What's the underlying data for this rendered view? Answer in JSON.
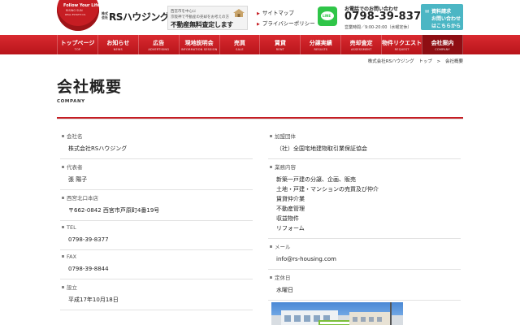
{
  "header": {
    "logo_circle_line1": "Follow Your Life",
    "logo_circle_line2": "RISING SUN",
    "logo_circle_line3": "REAL ESTATE CO.",
    "logo_prefix": "株式会社",
    "company_name": "RSハウジング",
    "banner_line1": "西宮市を中心に",
    "banner_line2": "京阪神で不動産の売却をお考えの方",
    "banner_line3": "不動産無料査定します",
    "links": [
      "サイトマップ",
      "プライバシーポリシー"
    ],
    "line_label": "LINE",
    "phone_label": "お電話でのお問い合わせ",
    "phone_number": "0798-39-8377",
    "hours": "営業時間／9:00-20:00（水曜定休）",
    "request_lines": [
      "資料請求",
      "お問い合わせ",
      "はこちらから"
    ]
  },
  "nav": {
    "items": [
      {
        "jp": "トップページ",
        "en": "TOP"
      },
      {
        "jp": "お知らせ",
        "en": "NEWS"
      },
      {
        "jp": "広告",
        "en": "ADVERTISING"
      },
      {
        "jp": "現地説明会",
        "en": "INFORMATION SESSION"
      },
      {
        "jp": "売買",
        "en": "SALE"
      },
      {
        "jp": "賃貸",
        "en": "RENT"
      },
      {
        "jp": "分譲実績",
        "en": "RESULTS"
      },
      {
        "jp": "売却査定",
        "en": "ASSESSMENT"
      },
      {
        "jp": "物件リクエスト",
        "en": "REQUEST"
      },
      {
        "jp": "会社案内",
        "en": "COMPANY"
      }
    ]
  },
  "breadcrumb": {
    "site": "株式会社RSハウジング",
    "home": "トップ",
    "sep": ">",
    "current": "会社概要"
  },
  "page": {
    "title": "会社概要",
    "subtitle": "COMPANY"
  },
  "info_left": [
    {
      "label": "会社名",
      "value": "株式会社RSハウジング"
    },
    {
      "label": "代表者",
      "value": "張 陽子"
    },
    {
      "label": "西宮北口本店",
      "value": "〒662-0842 西宮市芦原町4番19号"
    },
    {
      "label": "TEL",
      "value": "0798-39-8377"
    },
    {
      "label": "FAX",
      "value": "0798-39-8844"
    },
    {
      "label": "設立",
      "value": "平成17年10月18日"
    }
  ],
  "info_right": {
    "association": {
      "label": "加盟団体",
      "value": "（社）全国宅地建物取引業保証協会"
    },
    "business": {
      "label": "業務内容",
      "items": [
        "新築一戸建の分譲、企画、販売",
        "土地・戸建・マンションの売買及び仲介",
        "賃貸仲介業",
        "不動産管理",
        "収益物件",
        "リフォーム"
      ]
    },
    "mail": {
      "label": "メール",
      "value": "info@rs-housing.com"
    },
    "holiday": {
      "label": "定休日",
      "value": "水曜日"
    }
  }
}
